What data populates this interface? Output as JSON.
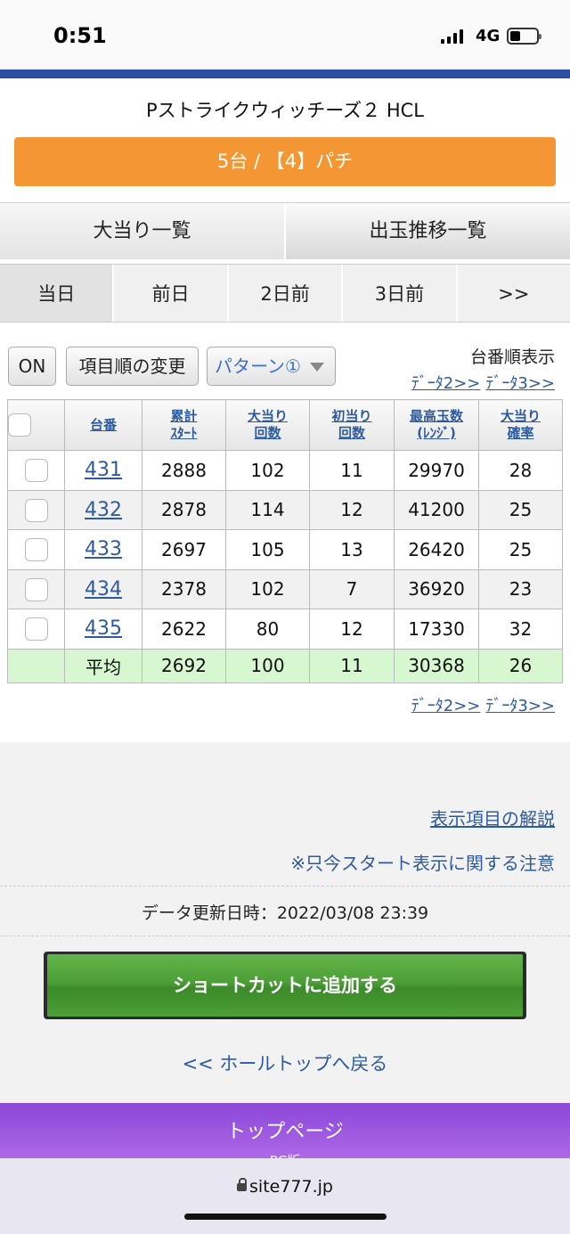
{
  "status_bar": {
    "time": "0:51",
    "network": "4G"
  },
  "header": {
    "machine_title": "Pストライクウィッチーズ２ HCL",
    "count_label": "5台 / 【4】パチ"
  },
  "tabs": [
    {
      "label": "大当り一覧"
    },
    {
      "label": "出玉推移一覧"
    }
  ],
  "days": [
    {
      "label": "当日"
    },
    {
      "label": "前日"
    },
    {
      "label": "2日前"
    },
    {
      "label": "3日前"
    },
    {
      "label": ">>"
    }
  ],
  "controls": {
    "on_label": "ON",
    "order_label": "項目順の変更",
    "pattern_label": "パターン①",
    "sort_label": "台番順表示",
    "data2_label": "ﾃﾞｰﾀ2>>",
    "data3_label": "ﾃﾞｰﾀ3>>"
  },
  "table": {
    "headers": [
      {
        "line1": "台番",
        "line2": ""
      },
      {
        "line1": "累計",
        "line2": "ｽﾀｰﾄ"
      },
      {
        "line1": "大当り",
        "line2": "回数"
      },
      {
        "line1": "初当り",
        "line2": "回数"
      },
      {
        "line1": "最高玉数",
        "line2": "(ﾚﾝｼﾞ)"
      },
      {
        "line1": "大当り",
        "line2": "確率"
      }
    ],
    "rows": [
      {
        "machine": "431",
        "start": "2888",
        "big": "102",
        "first": "11",
        "max": "29970",
        "prob": "28"
      },
      {
        "machine": "432",
        "start": "2878",
        "big": "114",
        "first": "12",
        "max": "41200",
        "prob": "25"
      },
      {
        "machine": "433",
        "start": "2697",
        "big": "105",
        "first": "13",
        "max": "26420",
        "prob": "25"
      },
      {
        "machine": "434",
        "start": "2378",
        "big": "102",
        "first": "7",
        "max": "36920",
        "prob": "23"
      },
      {
        "machine": "435",
        "start": "2622",
        "big": "80",
        "first": "12",
        "max": "17330",
        "prob": "32"
      }
    ],
    "average": {
      "label": "平均",
      "start": "2692",
      "big": "100",
      "first": "11",
      "max": "30368",
      "prob": "26"
    }
  },
  "footer": {
    "help_link": "表示項目の解説",
    "notice_link": "※只今スタート表示に関する注意",
    "updated": "データ更新日時：2022/03/08 23:39",
    "shortcut_button": "ショートカットに追加する",
    "back_link": "<< ホールトップへ戻る",
    "top_page": "トップページ",
    "pc_version": "PC版"
  },
  "browser": {
    "url": "site777.jp"
  },
  "colors": {
    "accent_orange": "#f39633",
    "accent_blue": "#2b4fa3",
    "link": "#2e5b9f",
    "shortcut_green": "#4d9e37",
    "average_row": "#d6f7d0",
    "menu_purple": "#9b55dd"
  }
}
